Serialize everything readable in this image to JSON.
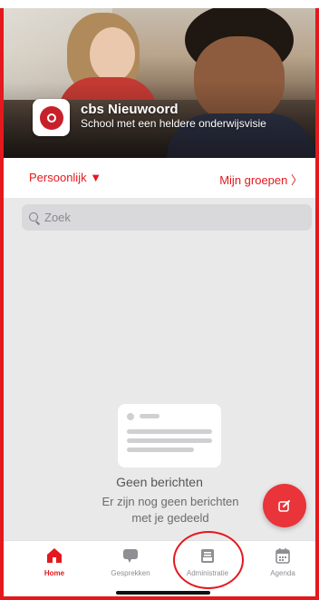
{
  "school": {
    "name": "cbs Nieuwoord",
    "subtitle": "School met een heldere onderwijsvisie"
  },
  "filter": {
    "left_label": "Persoonlijk ▼",
    "right_label": "Mijn groepen 〉"
  },
  "search": {
    "placeholder": "Zoek"
  },
  "empty_state": {
    "title": "Geen berichten",
    "description": "Er zijn nog geen berichten met je gedeeld"
  },
  "tabs": [
    {
      "label": "Home",
      "icon": "home-icon",
      "active": true
    },
    {
      "label": "Gesprekken",
      "icon": "chat-bubble-icon",
      "active": false
    },
    {
      "label": "Administratie",
      "icon": "tray-icon",
      "active": false
    },
    {
      "label": "Agenda",
      "icon": "calendar-icon",
      "active": false
    }
  ],
  "colors": {
    "accent": "#e3191e",
    "fab": "#e9343a",
    "inactive": "#8e8e93"
  }
}
